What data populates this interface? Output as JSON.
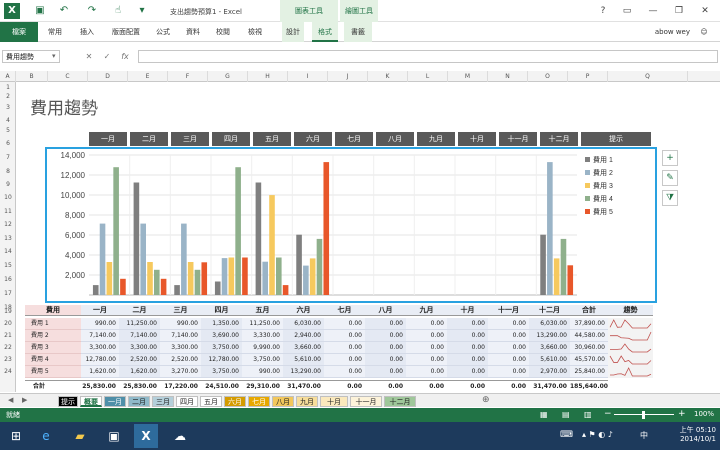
{
  "window": {
    "title": "支出趨勢預算1 - Excel",
    "context_tab_group_1": "圖表工具",
    "context_tab_group_2": "繪圖工具",
    "user": "abow wey",
    "app_icon_letter": "X"
  },
  "ribbon": {
    "tabs": [
      "檔案",
      "常用",
      "插入",
      "版面配置",
      "公式",
      "資料",
      "校閱",
      "檢視",
      "設計",
      "格式",
      "書籤"
    ]
  },
  "formula_bar": {
    "name_box": "費用趨勢",
    "fx": "fx",
    "cancel": "✕",
    "confirm": "✓",
    "value": ""
  },
  "columns": [
    "A",
    "B",
    "C",
    "D",
    "E",
    "F",
    "G",
    "H",
    "I",
    "J",
    "K",
    "L",
    "M",
    "N",
    "O",
    "P",
    "Q"
  ],
  "rows": [
    "1",
    "2",
    "3",
    "4",
    "5",
    "6",
    "7",
    "8",
    "9",
    "10",
    "11",
    "12",
    "13",
    "14",
    "15",
    "16",
    "17",
    "18",
    "19",
    "20",
    "21",
    "22",
    "23",
    "24"
  ],
  "sheet_title": "費用趨勢",
  "month_headers": [
    "一月",
    "二月",
    "三月",
    "四月",
    "五月",
    "六月",
    "七月",
    "八月",
    "九月",
    "十月",
    "十一月",
    "十二月"
  ],
  "hint_header": "提示",
  "chart_data": {
    "type": "bar",
    "categories": [
      "一月",
      "二月",
      "三月",
      "四月",
      "五月",
      "六月",
      "七月",
      "八月",
      "九月",
      "十月",
      "十一月",
      "十二月"
    ],
    "series": [
      {
        "name": "費用 1",
        "color": "#7f7f7f",
        "values": [
          990,
          11250,
          990,
          1350,
          11250,
          6030,
          0,
          0,
          0,
          0,
          0,
          6030
        ]
      },
      {
        "name": "費用 2",
        "color": "#9ab4c7",
        "values": [
          7140,
          7140,
          7140,
          3690,
          3330,
          2940,
          0,
          0,
          0,
          0,
          0,
          13290
        ]
      },
      {
        "name": "費用 3",
        "color": "#f6c95e",
        "values": [
          3300,
          3300,
          3300,
          3750,
          9990,
          3660,
          0,
          0,
          0,
          0,
          0,
          3660
        ]
      },
      {
        "name": "費用 4",
        "color": "#8fb08c",
        "values": [
          12780,
          2520,
          2520,
          12780,
          3750,
          5610,
          0,
          0,
          0,
          0,
          0,
          5610
        ]
      },
      {
        "name": "費用 5",
        "color": "#e8572a",
        "values": [
          1620,
          1620,
          3270,
          3750,
          990,
          13290,
          0,
          0,
          0,
          0,
          0,
          2970
        ]
      }
    ],
    "y_ticks": [
      "2,000",
      "4,000",
      "6,000",
      "8,000",
      "10,000",
      "12,000",
      "14,000"
    ],
    "ylim": [
      0,
      14000
    ],
    "legend_position": "right",
    "grid": true
  },
  "table": {
    "headers": [
      "費用",
      "一月",
      "二月",
      "三月",
      "四月",
      "五月",
      "六月",
      "七月",
      "八月",
      "九月",
      "十月",
      "十一月",
      "十二月",
      "合計",
      "趨勢"
    ],
    "rows": [
      {
        "label": "費用 1",
        "values": [
          "990.00",
          "11,250.00",
          "990.00",
          "1,350.00",
          "11,250.00",
          "6,030.00",
          "0.00",
          "0.00",
          "0.00",
          "0.00",
          "0.00",
          "6,030.00",
          "37,890.00"
        ]
      },
      {
        "label": "費用 2",
        "values": [
          "7,140.00",
          "7,140.00",
          "7,140.00",
          "3,690.00",
          "3,330.00",
          "2,940.00",
          "0.00",
          "0.00",
          "0.00",
          "0.00",
          "0.00",
          "13,290.00",
          "44,580.00"
        ]
      },
      {
        "label": "費用 3",
        "values": [
          "3,300.00",
          "3,300.00",
          "3,300.00",
          "3,750.00",
          "9,990.00",
          "3,660.00",
          "0.00",
          "0.00",
          "0.00",
          "0.00",
          "0.00",
          "3,660.00",
          "30,960.00"
        ]
      },
      {
        "label": "費用 4",
        "values": [
          "12,780.00",
          "2,520.00",
          "2,520.00",
          "12,780.00",
          "3,750.00",
          "5,610.00",
          "0.00",
          "0.00",
          "0.00",
          "0.00",
          "0.00",
          "5,610.00",
          "45,570.00"
        ]
      },
      {
        "label": "費用 5",
        "values": [
          "1,620.00",
          "1,620.00",
          "3,270.00",
          "3,750.00",
          "990.00",
          "13,290.00",
          "0.00",
          "0.00",
          "0.00",
          "0.00",
          "0.00",
          "2,970.00",
          "25,840.00"
        ]
      }
    ],
    "total": {
      "label": "合計",
      "values": [
        "25,830.00",
        "25,830.00",
        "17,220.00",
        "24,510.00",
        "29,310.00",
        "31,470.00",
        "0.00",
        "0.00",
        "0.00",
        "0.00",
        "0.00",
        "31,470.00",
        "185,640.00"
      ]
    }
  },
  "sheet_tabs": [
    {
      "label": "提示",
      "bg": "#000000",
      "fg": "#ffffff"
    },
    {
      "label": "概要",
      "bg": "#ffffff",
      "fg": "#217346"
    },
    {
      "label": "一月",
      "bg": "#4f8fa8",
      "fg": "#ffffff"
    },
    {
      "label": "二月",
      "bg": "#8fb9c9",
      "fg": "#222222"
    },
    {
      "label": "三月",
      "bg": "#b4cfda",
      "fg": "#222222"
    },
    {
      "label": "四月",
      "bg": "#ffffff",
      "fg": "#222222"
    },
    {
      "label": "五月",
      "bg": "#ffffff",
      "fg": "#222222"
    },
    {
      "label": "六月",
      "bg": "#d49b00",
      "fg": "#ffffff"
    },
    {
      "label": "七月",
      "bg": "#e7a800",
      "fg": "#ffffff"
    },
    {
      "label": "八月",
      "bg": "#f2c75c",
      "fg": "#222222"
    },
    {
      "label": "九月",
      "bg": "#f7dd9a",
      "fg": "#222222"
    },
    {
      "label": "十月",
      "bg": "#fbe9bd",
      "fg": "#222222"
    },
    {
      "label": "十一月",
      "bg": "#fdf3da",
      "fg": "#222222"
    },
    {
      "label": "十二月",
      "bg": "#9fc79a",
      "fg": "#222222"
    }
  ],
  "status": {
    "ready": "就緒",
    "zoom": "100%",
    "zoom_minus": "−",
    "zoom_plus": "+"
  },
  "taskbar": {
    "time": "上午 05:10",
    "date": "2014/10/1",
    "lang": "中"
  }
}
